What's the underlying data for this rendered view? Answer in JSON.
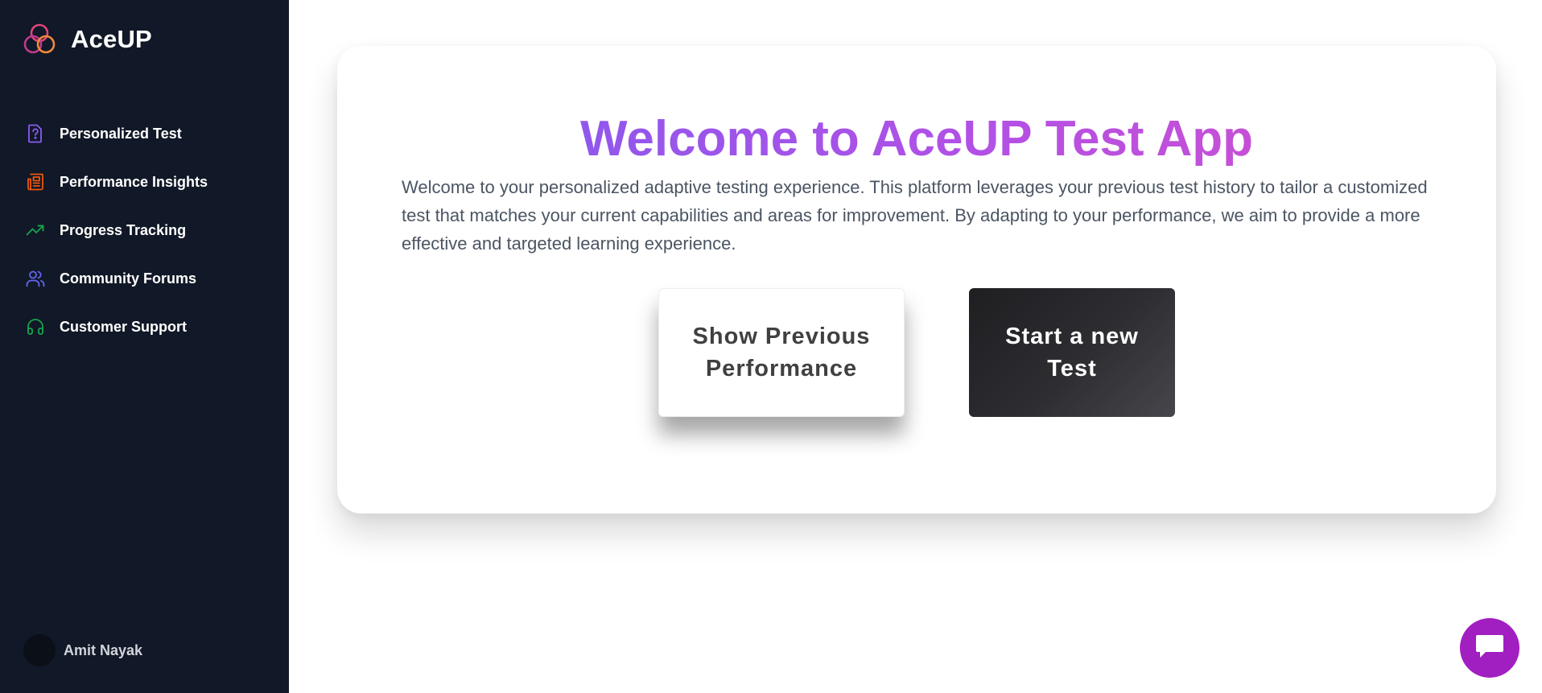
{
  "brand": {
    "name": "AceUP",
    "logo_icon": "triple-ring-logo-icon"
  },
  "sidebar": {
    "items": [
      {
        "label": "Personalized Test",
        "icon": "question-file-icon",
        "color": "#8b5cf6"
      },
      {
        "label": "Performance Insights",
        "icon": "newspaper-icon",
        "color": "#ea580c"
      },
      {
        "label": "Progress Tracking",
        "icon": "trend-up-icon",
        "color": "#16a34a"
      },
      {
        "label": "Community Forums",
        "icon": "users-icon",
        "color": "#6366f1"
      },
      {
        "label": "Customer Support",
        "icon": "headphones-icon",
        "color": "#16a34a"
      }
    ]
  },
  "user": {
    "name": "Amit Nayak"
  },
  "main": {
    "title": "Welcome to AceUP Test App",
    "description": "Welcome to your personalized adaptive testing experience. This platform leverages your previous test history to tailor a customized test that matches your current capabilities and areas for improvement. By adapting to your performance, we aim to provide a more effective and targeted learning experience.",
    "buttons": {
      "show_previous": "Show Previous Performance",
      "start_new": "Start a new Test"
    }
  },
  "chat": {
    "icon": "chat-bubble-icon"
  },
  "colors": {
    "sidebar_bg": "#111827",
    "title_gradient_start": "#7c5cf0",
    "title_gradient_end": "#d64fc9",
    "chat_fab": "#a11fc1"
  }
}
